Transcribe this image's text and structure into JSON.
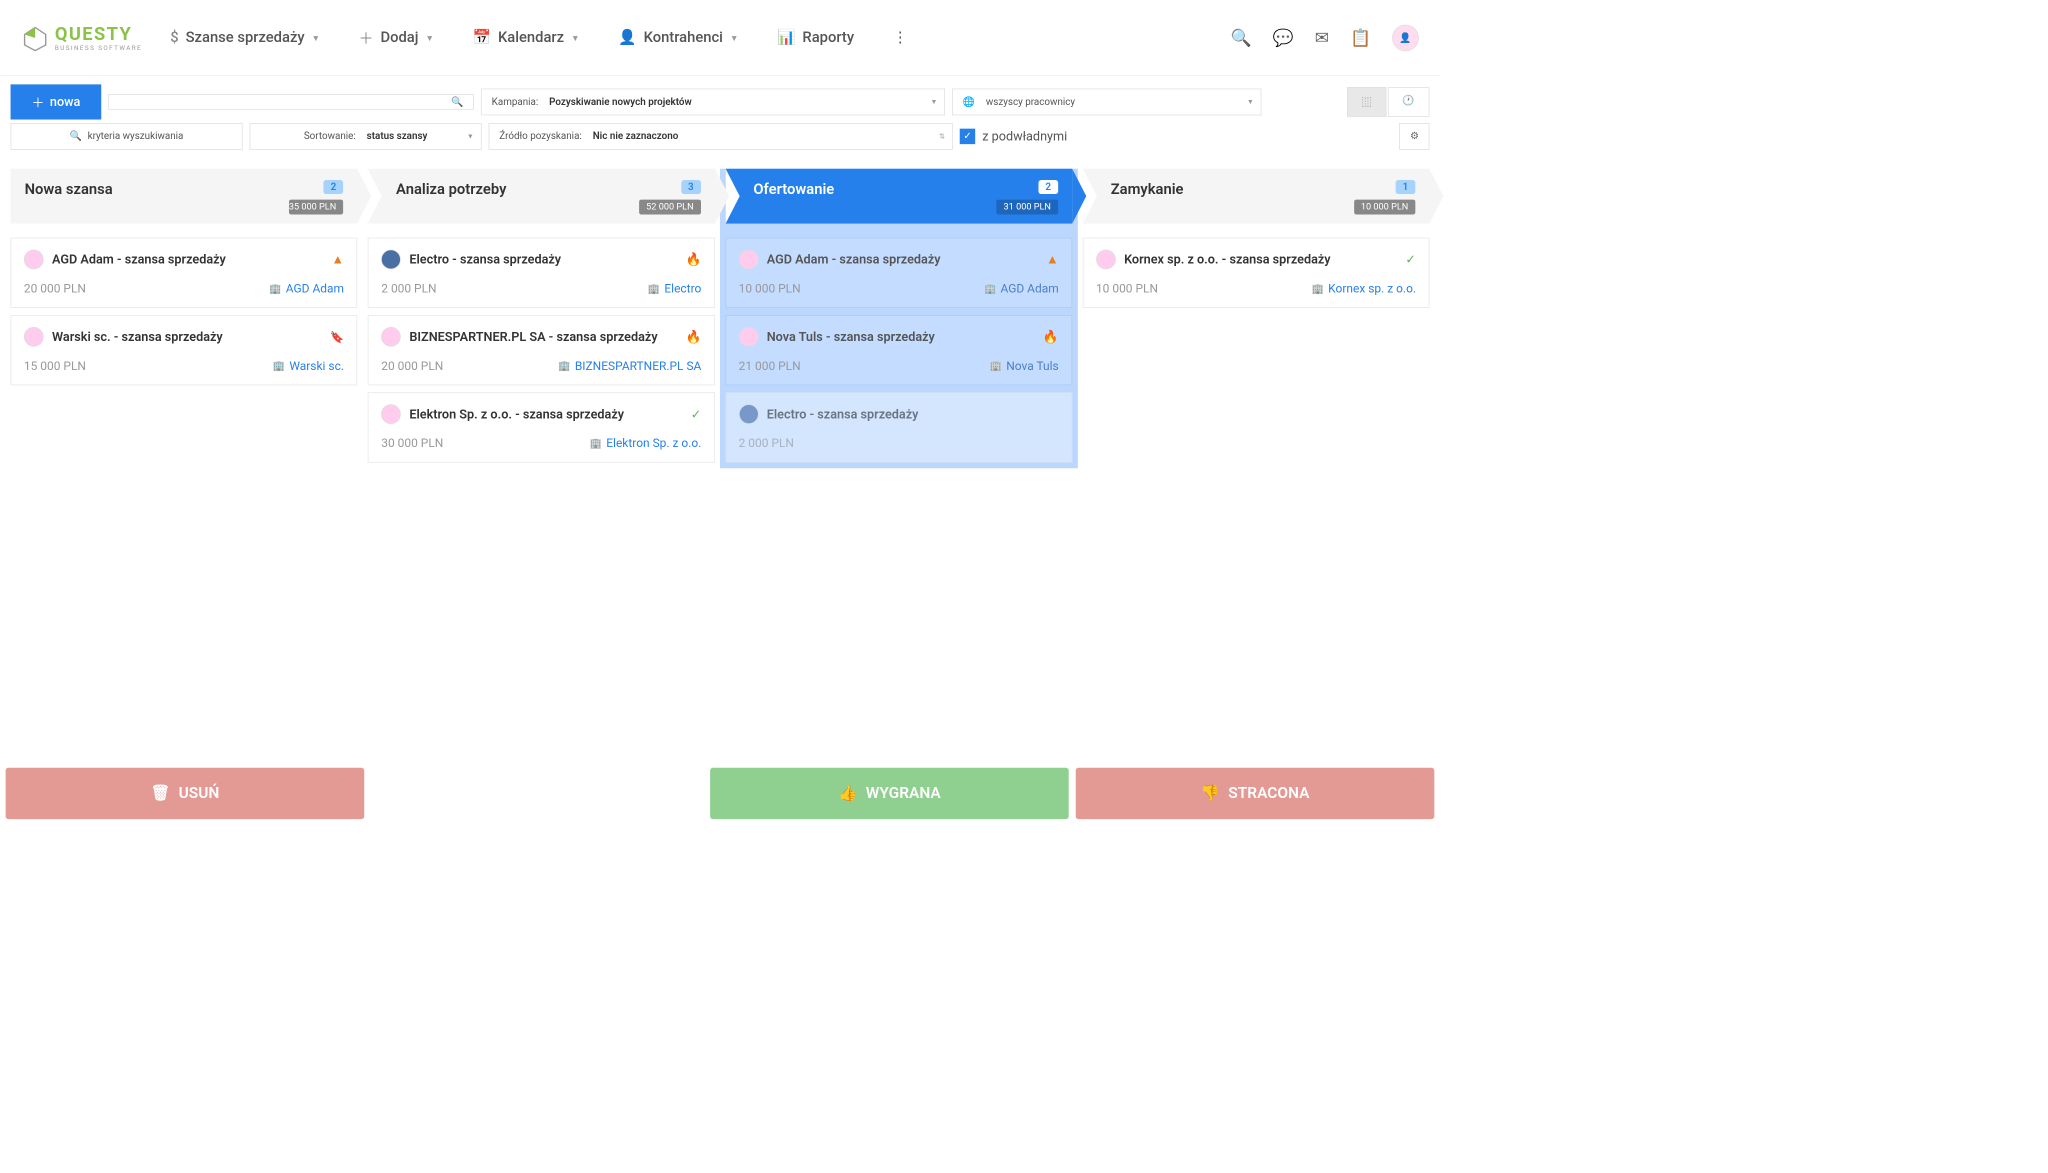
{
  "logo": {
    "main": "QUESTY",
    "sub": "BUSINESS SOFTWARE"
  },
  "nav": {
    "sales": "Szanse sprzedaży",
    "add": "Dodaj",
    "calendar": "Kalendarz",
    "contractors": "Kontrahenci",
    "reports": "Raporty"
  },
  "toolbar": {
    "new": "nowa",
    "campaign_label": "Kampania:",
    "campaign_value": "Pozyskiwanie nowych projektów",
    "employees": "wszyscy pracownicy",
    "criteria": "kryteria wyszukiwania",
    "sort_label": "Sortowanie:",
    "sort_value": "status szansy",
    "source_label": "Źródło pozyskania:",
    "source_value": "Nic nie zaznaczono",
    "subordinates": "z podwładnymi"
  },
  "columns": [
    {
      "title": "Nowa szansa",
      "count": "2",
      "sum": "35 000 PLN",
      "active": false,
      "cards": [
        {
          "title": "AGD Adam - szansa sprzedaży",
          "amount": "20 000 PLN",
          "company": "AGD Adam",
          "status": "warn",
          "avatar": "light"
        },
        {
          "title": "Warski sc. - szansa sprzedaży",
          "amount": "15 000 PLN",
          "company": "Warski sc.",
          "status": "book",
          "avatar": "light"
        }
      ]
    },
    {
      "title": "Analiza potrzeby",
      "count": "3",
      "sum": "52 000 PLN",
      "active": false,
      "cards": [
        {
          "title": "Electro - szansa sprzedaży",
          "amount": "2 000 PLN",
          "company": "Electro",
          "status": "fire",
          "avatar": "blue"
        },
        {
          "title": "BIZNESPARTNER.PL SA - szansa sprzedaży",
          "amount": "20 000 PLN",
          "company": "BIZNESPARTNER.PL SA",
          "status": "fire",
          "avatar": "light"
        },
        {
          "title": "Elektron Sp. z o.o. - szansa sprzedaży",
          "amount": "30 000 PLN",
          "company": "Elektron Sp. z o.o.",
          "status": "check",
          "avatar": "light"
        }
      ]
    },
    {
      "title": "Ofertowanie",
      "count": "2",
      "sum": "31 000 PLN",
      "active": true,
      "cards": [
        {
          "title": "AGD Adam - szansa sprzedaży",
          "amount": "10 000 PLN",
          "company": "AGD Adam",
          "status": "warn",
          "avatar": "light",
          "ghost": true
        },
        {
          "title": "Nova Tuls - szansa sprzedaży",
          "amount": "21 000 PLN",
          "company": "Nova Tuls",
          "status": "fire",
          "avatar": "light",
          "ghost": true
        },
        {
          "title": "Electro - szansa sprzedaży",
          "amount": "2 000 PLN",
          "company": "",
          "status": "",
          "avatar": "blue",
          "drag": true
        }
      ]
    },
    {
      "title": "Zamykanie",
      "count": "1",
      "sum": "10 000 PLN",
      "active": false,
      "cards": [
        {
          "title": "Kornex sp. z o.o. - szansa sprzedaży",
          "amount": "10 000 PLN",
          "company": "Kornex sp. z o.o.",
          "status": "check",
          "avatar": "light"
        }
      ]
    }
  ],
  "footer": {
    "delete": "USUŃ",
    "won": "WYGRANA",
    "lost": "STRACONA"
  }
}
